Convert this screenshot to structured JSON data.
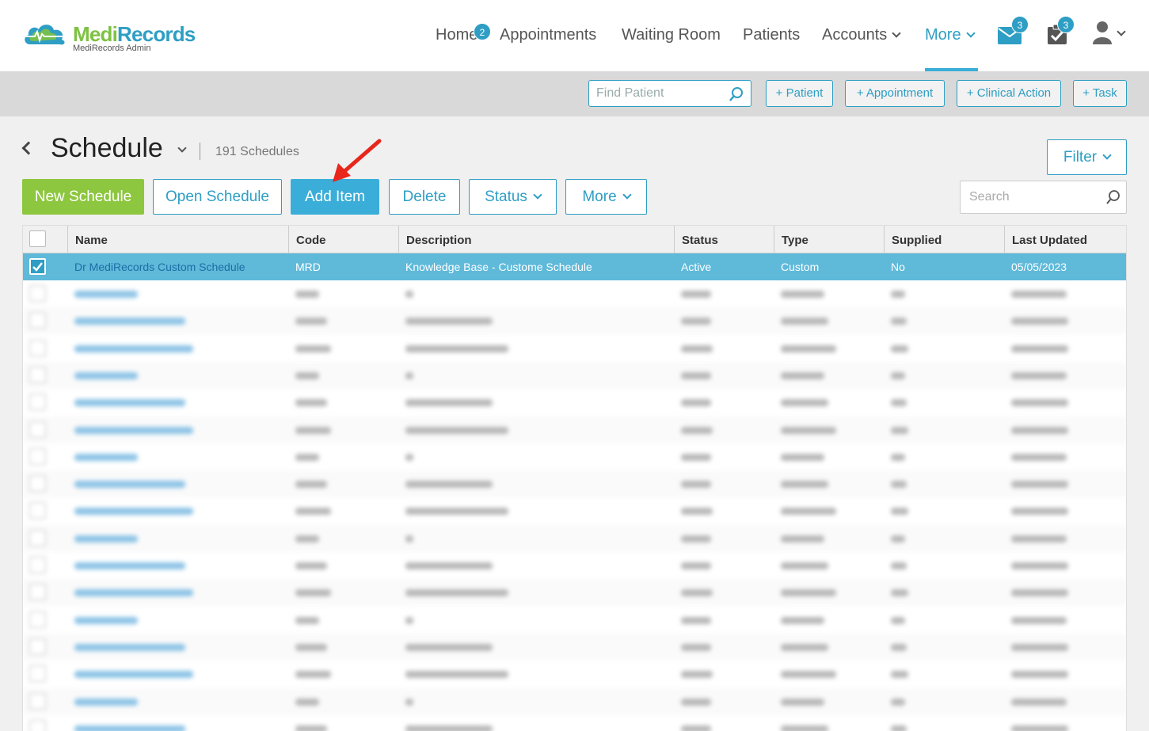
{
  "brand": {
    "name_part1": "Medi",
    "name_part2": "Records",
    "subtitle": "MediRecords Admin"
  },
  "nav": {
    "home": "Home",
    "home_badge": "2",
    "appointments": "Appointments",
    "waiting_room": "Waiting Room",
    "patients": "Patients",
    "accounts": "Accounts",
    "more": "More",
    "messages_badge": "3",
    "tasks_badge": "3"
  },
  "actionbar": {
    "find_placeholder": "Find Patient",
    "add_patient": "+ Patient",
    "add_appointment": "+ Appointment",
    "add_clinical_action": "+ Clinical Action",
    "add_task": "+ Task"
  },
  "page": {
    "title": "Schedule",
    "count": "191 Schedules"
  },
  "toolbar": {
    "new_schedule": "New Schedule",
    "open_schedule": "Open Schedule",
    "add_item": "Add Item",
    "delete": "Delete",
    "status": "Status",
    "more": "More",
    "filter": "Filter",
    "search_placeholder": "Search"
  },
  "table": {
    "columns": [
      "Name",
      "Code",
      "Description",
      "Status",
      "Type",
      "Supplied",
      "Last Updated"
    ],
    "selected_row": {
      "name": "Dr MediRecords Custom Schedule",
      "code": "MRD",
      "description": "Knowledge Base - Custome Schedule",
      "status": "Active",
      "type": "Custom",
      "supplied": "No",
      "last_updated": "05/05/2023"
    }
  },
  "colors": {
    "brand_green": "#8dc63f",
    "brand_blue": "#2e9ec4",
    "selected_row": "#5fb9d9",
    "annotation_arrow": "#e8261c"
  }
}
